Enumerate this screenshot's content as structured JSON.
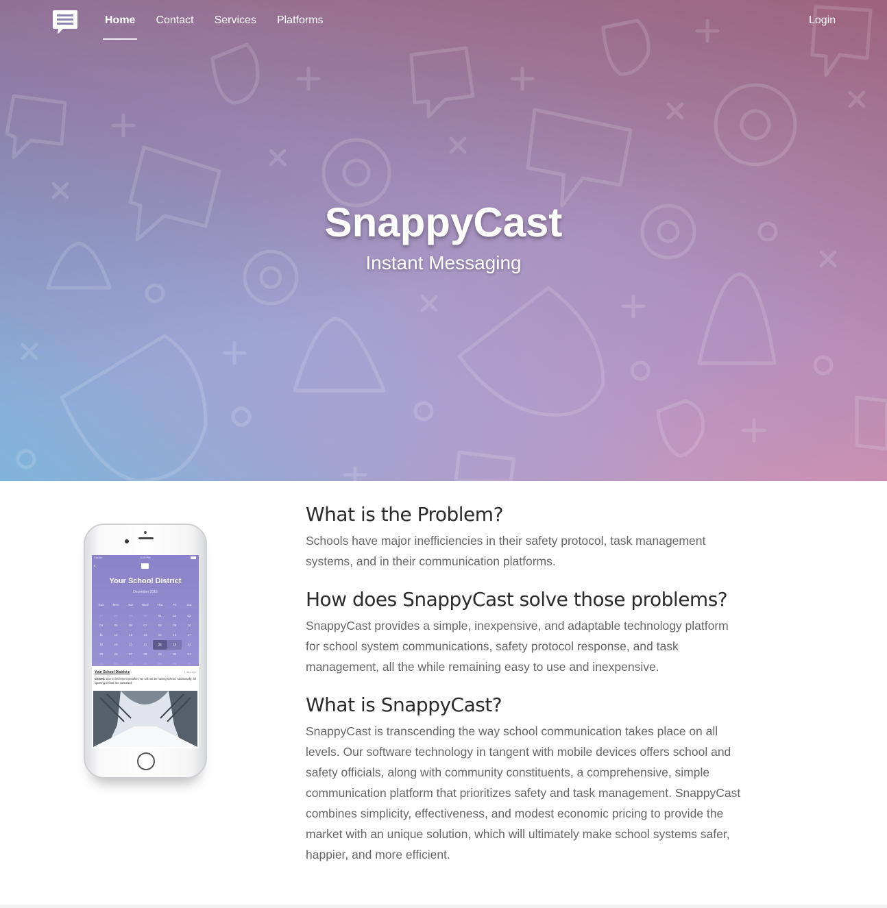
{
  "nav": {
    "logo_icon": "chat-message-icon",
    "links": [
      {
        "label": "Home",
        "active": true
      },
      {
        "label": "Contact",
        "active": false
      },
      {
        "label": "Services",
        "active": false
      },
      {
        "label": "Platforms",
        "active": false
      }
    ],
    "login_label": "Login"
  },
  "hero": {
    "title": "SnappyCast",
    "subtitle": "Instant Messaging",
    "background_icons": [
      "speech-bubble-icon",
      "gear-icon",
      "bell-icon",
      "shield-icon",
      "plus-icon",
      "x-icon",
      "ring-icon"
    ]
  },
  "phone": {
    "status_carrier": "Carrier",
    "status_time": "3:03 PM",
    "district_title": "Your School District",
    "month_label": "December 2016",
    "weekdays": [
      "Sun",
      "Mon",
      "Tue",
      "Wed",
      "Thu",
      "Fri",
      "Sat"
    ],
    "weeks": [
      [
        "27",
        "28",
        "29",
        "30",
        "01",
        "02",
        "03"
      ],
      [
        "04",
        "05",
        "06",
        "07",
        "08",
        "09",
        "10"
      ],
      [
        "11",
        "12",
        "13",
        "14",
        "15",
        "16",
        "17"
      ],
      [
        "18",
        "19",
        "20",
        "21",
        "22",
        "23",
        "24"
      ],
      [
        "25",
        "26",
        "27",
        "28",
        "29",
        "30",
        "31"
      ],
      [
        "01",
        "02",
        "03",
        "04",
        "05",
        "06",
        "07"
      ]
    ],
    "message_header": "Your School District ▸",
    "message_time": "1 day ago",
    "message_bold": "Closed:",
    "message_body": " Due to inclement weather, we will not be having school. Additionally, all sporting events are canceled!"
  },
  "sections": [
    {
      "heading": "What is the Problem?",
      "body": "Schools have major inefficiencies in their safety protocol, task management systems, and in their communication platforms."
    },
    {
      "heading": "How does SnappyCast solve those problems?",
      "body": "SnappyCast provides a simple, inexpensive, and adaptable technology platform for school system communications, safety protocol response, and task management, all the while remaining easy to use and inexpensive."
    },
    {
      "heading": "What is SnappyCast?",
      "body": "SnappyCast is transcending the way school communication takes place on all levels. Our software technology in tangent with mobile devices offers school and safety officials, along with community constituents, a comprehensive, simple communication platform that prioritizes safety and task management. SnappyCast combines simplicity, effectiveness, and modest economic pricing to provide the market with an unique solution, which will ultimately make school systems safer, happier, and more efficient."
    }
  ]
}
